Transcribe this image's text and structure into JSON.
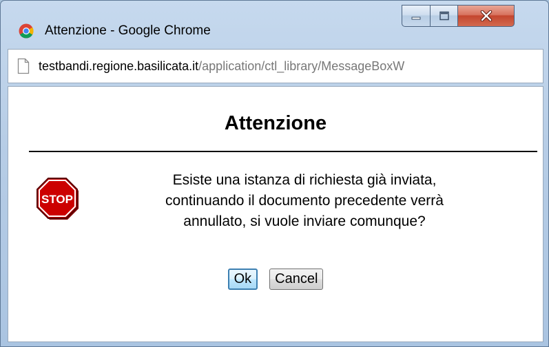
{
  "window": {
    "title": "Attenzione - Google Chrome",
    "controls": {
      "minimize_icon": "minimize-icon",
      "maximize_icon": "maximize-icon",
      "close_icon": "close-icon"
    }
  },
  "addressbar": {
    "url_host": "testbandi.regione.basilicata.it",
    "url_path": "/application/ctl_library/MessageBoxW"
  },
  "dialog": {
    "title": "Attenzione",
    "icon": "stop-icon",
    "icon_text": "STOP",
    "message_lines": [
      "Esiste una istanza di richiesta già inviata,",
      "continuando il documento precedente verrà",
      "annullato, si vuole inviare comunque?"
    ],
    "ok_label": "Ok",
    "cancel_label": "Cancel"
  },
  "colors": {
    "stop_red": "#cc0000",
    "stop_border": "#7a0000",
    "chrome_frame": "#b7cde6",
    "close_button": "#c4462e"
  }
}
